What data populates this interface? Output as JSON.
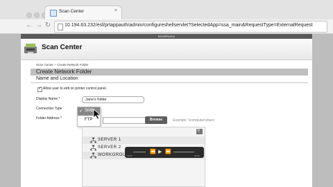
{
  "browser": {
    "tab_title": "Scan Center",
    "tab_close": "×",
    "url": "10.194.63.232/esf/prtappauth/admin/configureshellservlet?SelectedApp=ssa_main&RequestType=ExternalRequest"
  },
  "app": {
    "model_name": "ModelName",
    "title": "Scan Center"
  },
  "breadcrumb": {
    "root": "Scan Center",
    "separator": ">",
    "current": "Create Network Folder"
  },
  "page": {
    "title": "Create Network Folder",
    "section": "Name and Location"
  },
  "form": {
    "allow_edit_label": "Allow user to edit on printer control panel.",
    "allow_edit_checked": true,
    "display_name_label": "Display Name *",
    "display_name_value": "Jane's folder",
    "connection_type_label": "Connection Type",
    "connection_options": [
      "SMB",
      "FTP"
    ],
    "connection_selected": "SMB",
    "folder_address_label": "Folder Address *",
    "browse_label": "Browse",
    "example_text": "Example: \\\\computer\\share"
  },
  "tree": {
    "items": [
      "SERVER 1",
      "SERVER 2",
      "WORKGROUP"
    ]
  },
  "player": {
    "time_elapsed": "00:44",
    "time_remaining": "00:56"
  },
  "icons": {
    "search": "search-icon",
    "network": "network-icon",
    "checkmark": "checkmark-icon"
  },
  "colors": {
    "model_bar": "#595959",
    "title_bar": "#bfbfbf",
    "browse_button": "#5e5e5e",
    "gutter": "#bdbdbd"
  }
}
